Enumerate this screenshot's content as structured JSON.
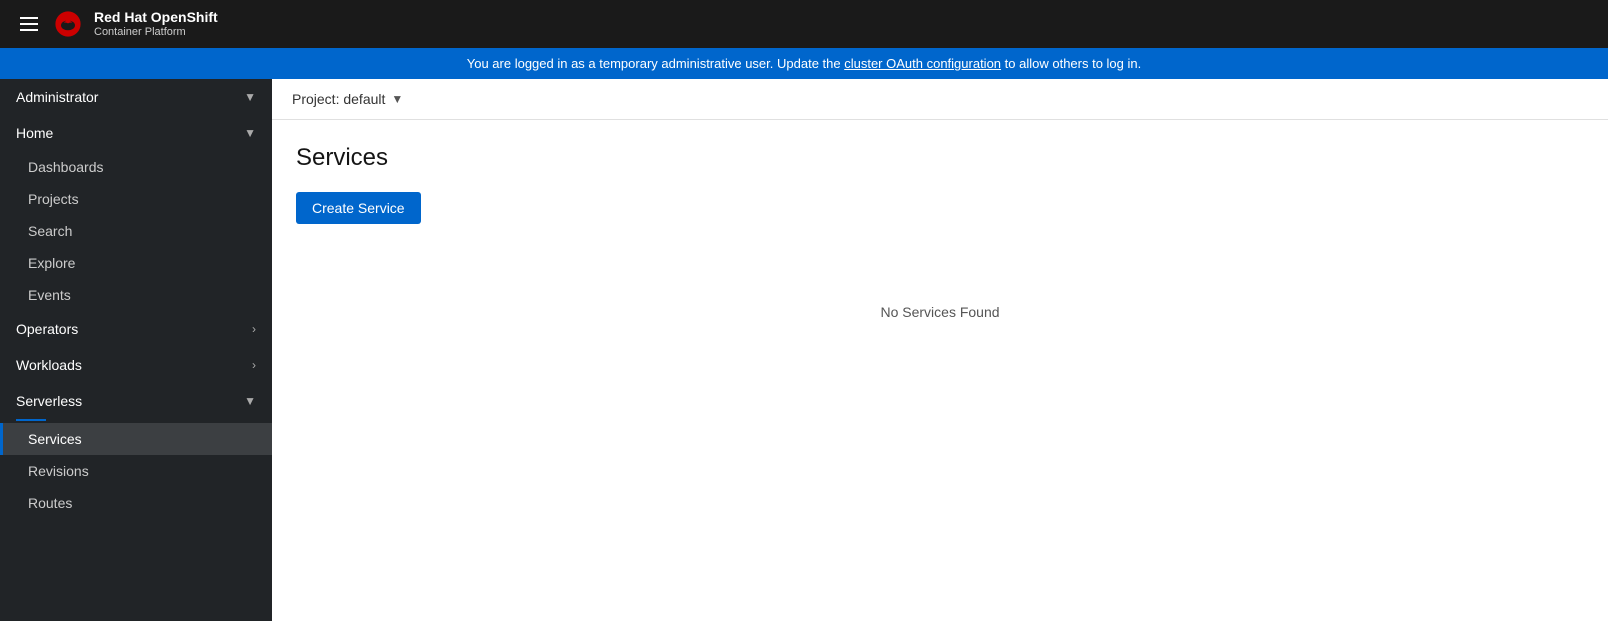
{
  "topbar": {
    "brand_main": "Red Hat",
    "brand_openshift": "OpenShift",
    "brand_sub": "Container Platform"
  },
  "alert": {
    "message_pre": "You are logged in as a temporary administrative user. Update the ",
    "link_text": "cluster OAuth configuration",
    "message_post": " to allow others to log in."
  },
  "sidebar": {
    "role_label": "Administrator",
    "sections": [
      {
        "label": "Home",
        "expanded": true,
        "items": [
          "Dashboards",
          "Projects",
          "Search",
          "Explore",
          "Events"
        ]
      },
      {
        "label": "Operators",
        "expanded": false,
        "items": []
      },
      {
        "label": "Workloads",
        "expanded": false,
        "items": []
      },
      {
        "label": "Serverless",
        "expanded": true,
        "items": [
          "Services",
          "Revisions",
          "Routes"
        ]
      }
    ]
  },
  "project_bar": {
    "label": "Project: default"
  },
  "page": {
    "title": "Services",
    "create_button": "Create Service",
    "empty_message": "No Services Found"
  }
}
